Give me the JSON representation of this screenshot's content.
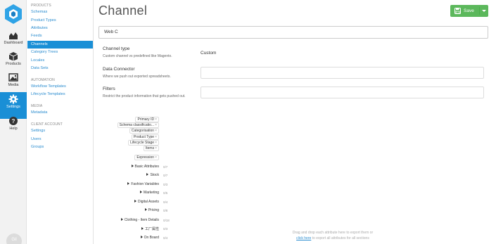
{
  "rail": {
    "items": [
      {
        "label": "Dashboard"
      },
      {
        "label": "Products"
      },
      {
        "label": "Media"
      },
      {
        "label": "Settings"
      },
      {
        "label": "Help"
      }
    ],
    "avatar": "Gil"
  },
  "nav": {
    "sections": [
      {
        "heading": "PRODUCTS",
        "items": [
          "Schemas",
          "Product Types",
          "Attributes",
          "Feeds",
          "Channels",
          "Category Trees",
          "Locales",
          "Data Sets"
        ]
      },
      {
        "heading": "AUTOMATION",
        "items": [
          "Workflow Templates",
          "Lifecycle Templates"
        ]
      },
      {
        "heading": "MEDIA",
        "items": [
          "Metadata"
        ]
      },
      {
        "heading": "CLIENT ACCOUNT",
        "items": [
          "Settings",
          "Users",
          "Groups"
        ]
      }
    ]
  },
  "main": {
    "title": "Channel",
    "save_label": "Save",
    "name_value": "Web C",
    "channel_type": {
      "label": "Channel type",
      "help": "Custom channel vs predefined like Magento.",
      "value": "Custom"
    },
    "data_connector": {
      "label": "Data Connector",
      "help": "Where we push out exported spreadsheets."
    },
    "filters": {
      "label": "Filters",
      "help": "Restrict the product information that gets pushed out."
    },
    "tags": [
      "Primary ID",
      "Schema classificatio...",
      "Categorisation",
      "Product Type",
      "Lifecycle Stage",
      "Items",
      "Expression"
    ],
    "groups": [
      {
        "name": "Basic Attributes",
        "count": "0/7"
      },
      {
        "name": "Stock",
        "count": "0/7"
      },
      {
        "name": "Fashion Variables",
        "count": "0/3"
      },
      {
        "name": "Marketing",
        "count": "0/5"
      },
      {
        "name": "Digital Assets",
        "count": "0/4"
      },
      {
        "name": "Pricing",
        "count": "0/8"
      },
      {
        "name": "Clothing - Item Details",
        "count": "0/18"
      },
      {
        "name": "工厂属性",
        "count": "0/3"
      },
      {
        "name": "On Board",
        "count": "0/4"
      }
    ],
    "hint_line1": "Drag and drop each attribute here to export them or",
    "hint_link": "click here",
    "hint_line2": "to export all attributes for all sections"
  },
  "colors": {
    "accent": "#1a8fd6",
    "save": "#5cb85c",
    "link": "#2a8ccf"
  }
}
